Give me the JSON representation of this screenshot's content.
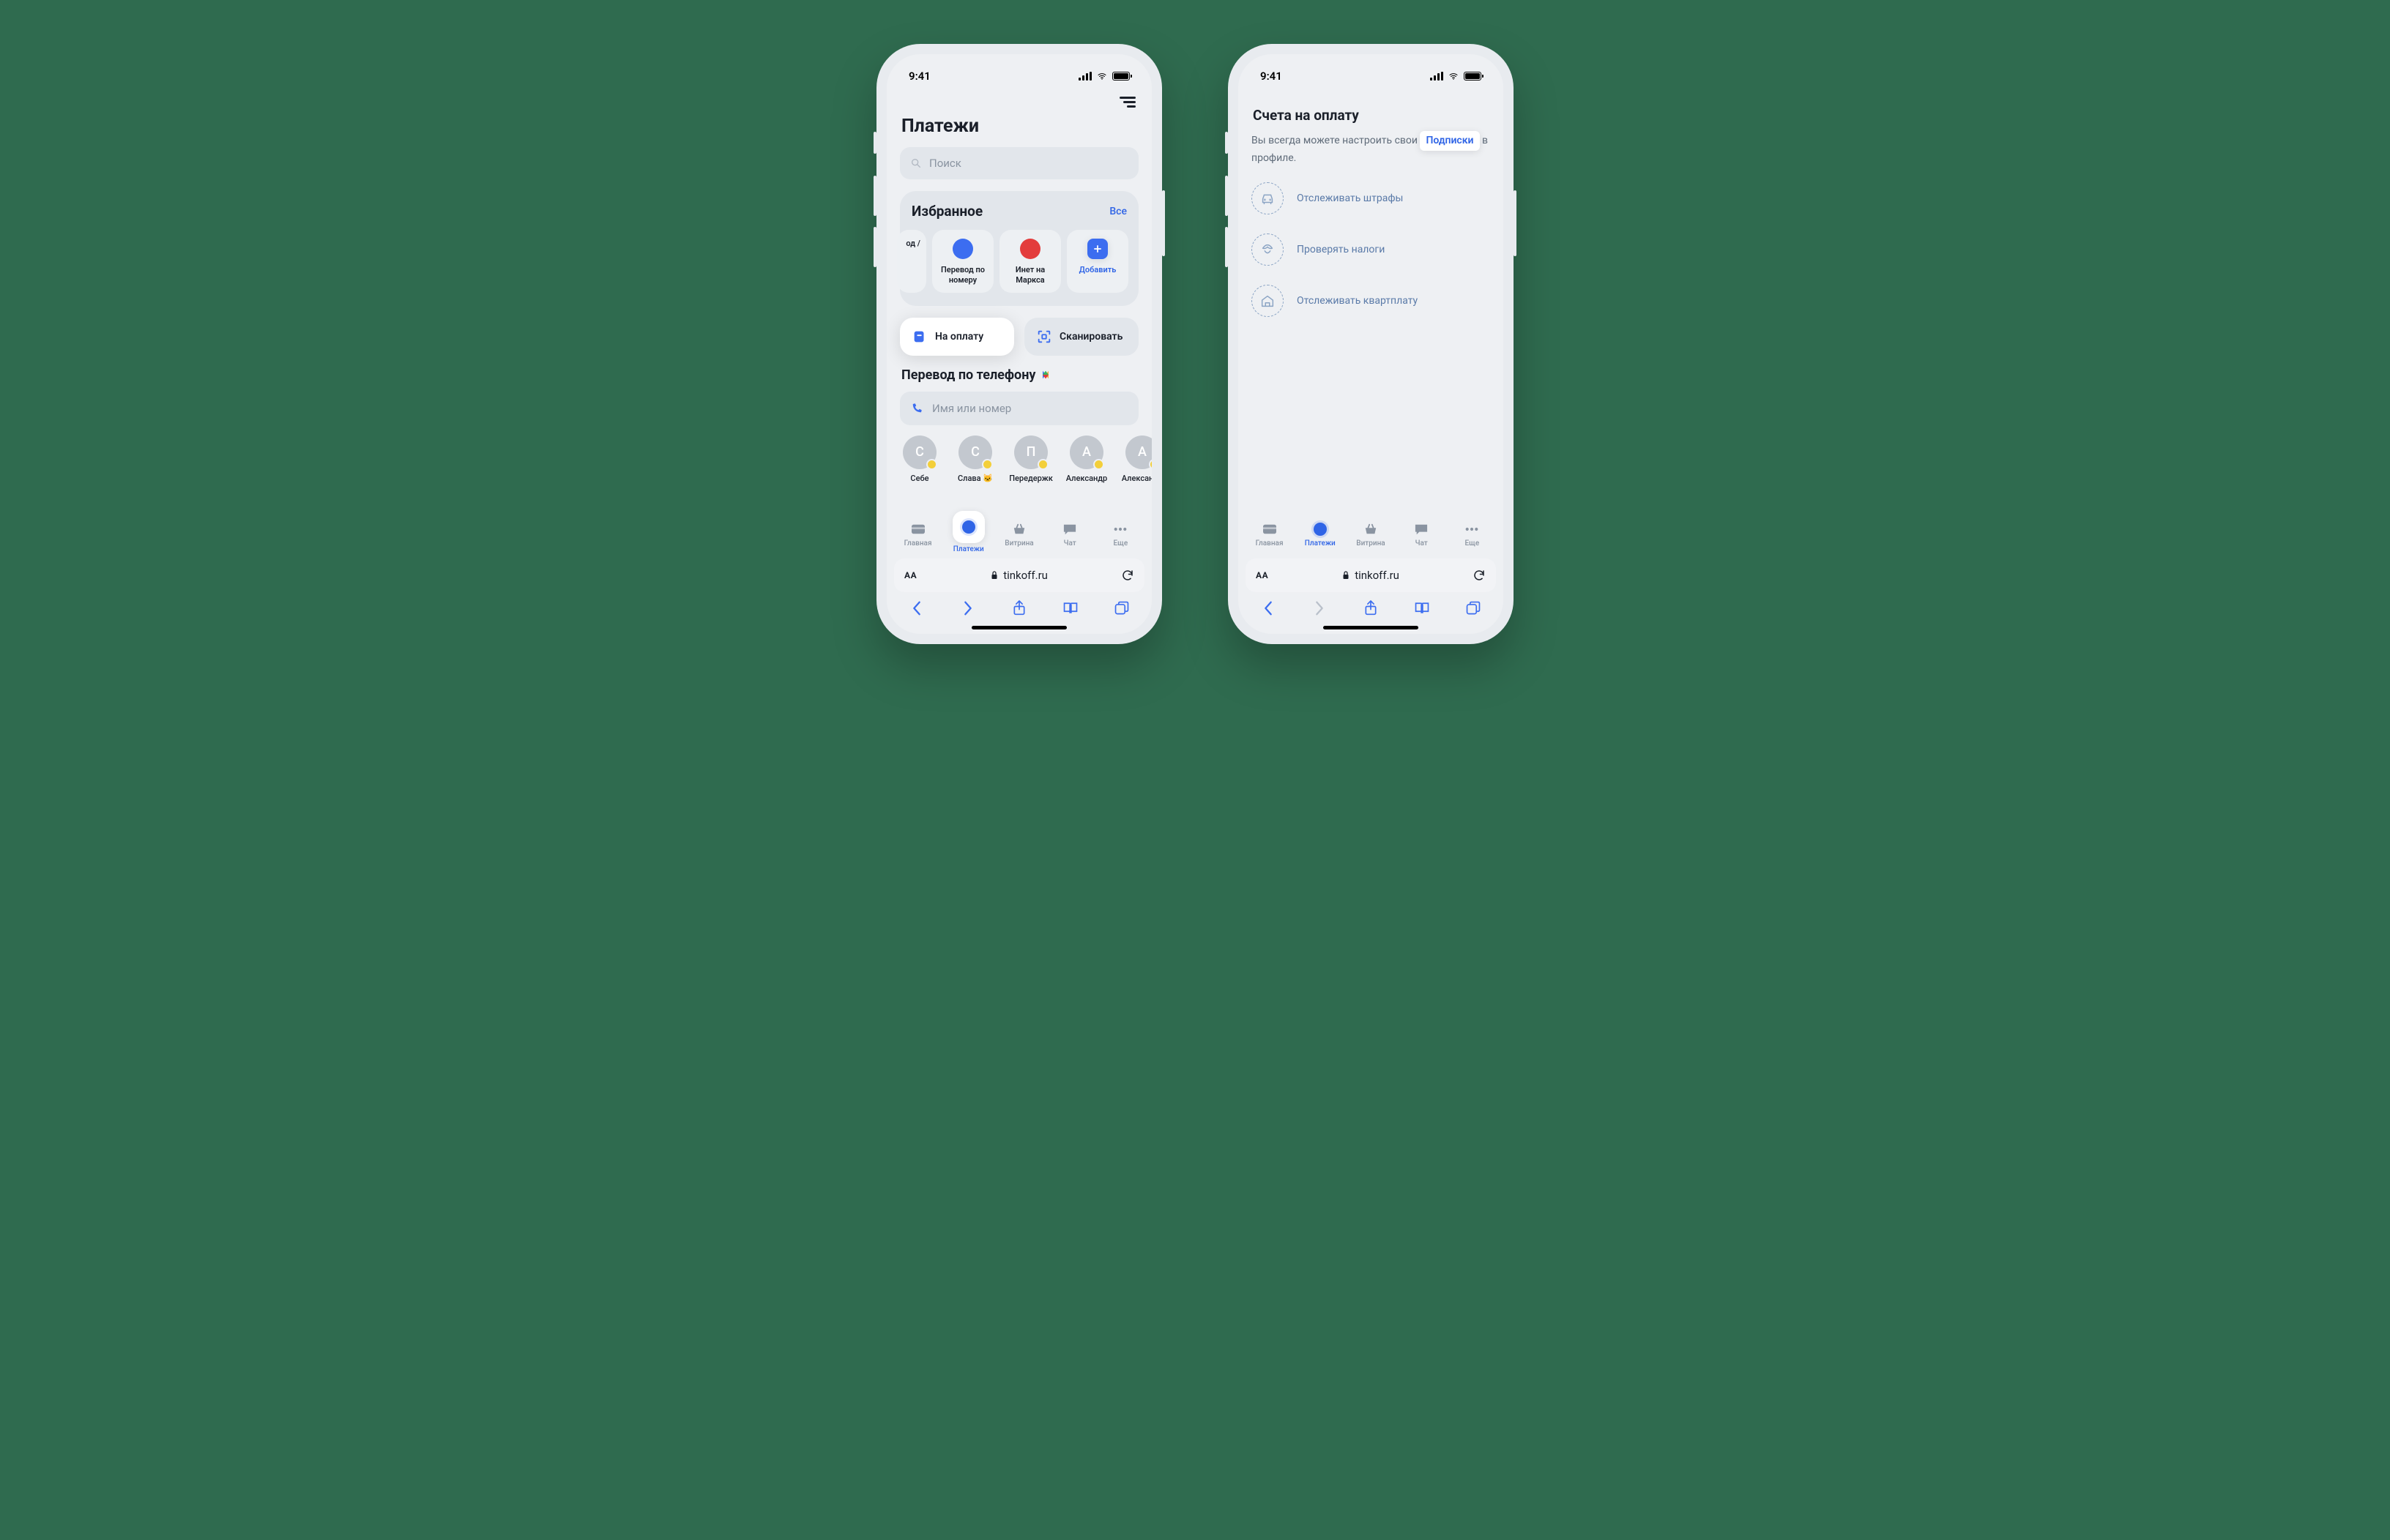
{
  "status": {
    "time": "9:41"
  },
  "screenA": {
    "page_title": "Платежи",
    "search_placeholder": "Поиск",
    "favorites": {
      "title": "Избранное",
      "all": "Все",
      "items": [
        {
          "label": "од /"
        },
        {
          "label": "Перевод по номеру"
        },
        {
          "label": "Инет на Маркса"
        },
        {
          "label": "Добавить"
        }
      ]
    },
    "pills": {
      "pay": "На оплату",
      "scan": "Сканировать"
    },
    "transfer": {
      "title": "Перевод по телефону",
      "placeholder": "Имя или номер",
      "contacts": [
        {
          "initial": "С",
          "name": "Себе"
        },
        {
          "initial": "С",
          "name": "Слава 🐱"
        },
        {
          "initial": "П",
          "name": "Передержк"
        },
        {
          "initial": "А",
          "name": "Александр"
        },
        {
          "initial": "А",
          "name": "Александр"
        }
      ]
    },
    "tabs": [
      {
        "label": "Главная"
      },
      {
        "label": "Платежи"
      },
      {
        "label": "Витрина"
      },
      {
        "label": "Чат"
      },
      {
        "label": "Еще"
      }
    ]
  },
  "screenB": {
    "title": "Счета на оплату",
    "desc_pre": "Вы всегда можете настроить свои ",
    "chip": "Подписки",
    "desc_post": " в профиле.",
    "items": [
      {
        "label": "Отслеживать штрафы"
      },
      {
        "label": "Проверять налоги"
      },
      {
        "label": "Отслеживать квартплату"
      }
    ]
  },
  "browser": {
    "aa": "AA",
    "host": "tinkoff.ru"
  }
}
